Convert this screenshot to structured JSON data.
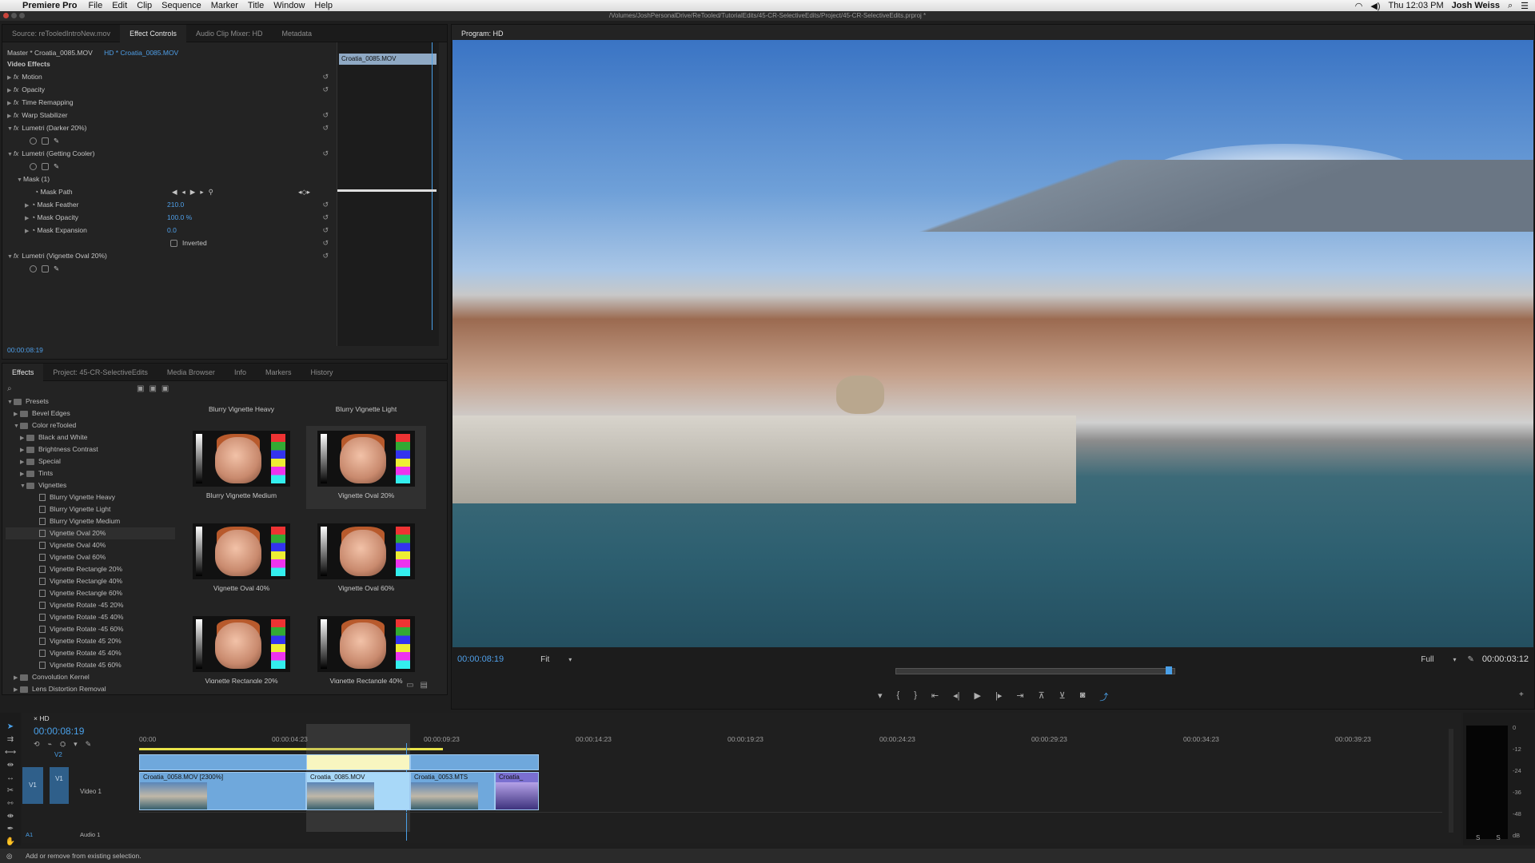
{
  "menubar": {
    "app_name": "Premiere Pro",
    "items": [
      "File",
      "Edit",
      "Clip",
      "Sequence",
      "Marker",
      "Title",
      "Window",
      "Help"
    ],
    "clock": "Thu 12:03 PM",
    "user": "Josh Weiss"
  },
  "window_title": "/Volumes/JoshPersonalDrive/ReTooled/TutorialEdits/45-CR-SelectiveEdits/Project/45-CR-SelectiveEdits.prproj *",
  "top_left_tabs": [
    "Source: reTooledIntroNew.mov",
    "Effect Controls",
    "Audio Clip Mixer: HD",
    "Metadata"
  ],
  "effect_controls": {
    "master_label": "Master * Croatia_0085.MOV",
    "sequence_label": "HD * Croatia_0085.MOV",
    "section": "Video Effects",
    "mini_clip": "Croatia_0085.MOV",
    "effects": [
      "Motion",
      "Opacity",
      "Time Remapping",
      "Warp Stabilizer",
      "Lumetri (Darker 20%)",
      "Lumetri (Getting Cooler)"
    ],
    "mask": "Mask (1)",
    "mask_props": [
      {
        "name": "Mask Path",
        "value": ""
      },
      {
        "name": "Mask Feather",
        "value": "210.0"
      },
      {
        "name": "Mask Opacity",
        "value": "100.0 %"
      },
      {
        "name": "Mask Expansion",
        "value": "0.0"
      }
    ],
    "inverted_label": "Inverted",
    "last_effect": "Lumetri (Vignette Oval 20%)",
    "timecode": "00:00:08:19"
  },
  "bottom_left_tabs": [
    "Effects",
    "Project: 45-CR-SelectiveEdits",
    "Media Browser",
    "Info",
    "Markers",
    "History"
  ],
  "effects_tree": [
    "Presets",
    "Bevel Edges",
    "Color reTooled",
    "Black and White",
    "Brightness Contrast",
    "Special",
    "Tints",
    "Vignettes",
    "Blurry Vignette Heavy",
    "Blurry Vignette Light",
    "Blurry Vignette Medium",
    "Vignette Oval 20%",
    "Vignette Oval 40%",
    "Vignette Oval 60%",
    "Vignette Rectangle 20%",
    "Vignette Rectangle 40%",
    "Vignette Rectangle 60%",
    "Vignette Rotate -45 20%",
    "Vignette Rotate -45 40%",
    "Vignette Rotate -45 60%",
    "Vignette Rotate 45 20%",
    "Vignette Rotate 45 40%",
    "Vignette Rotate 45 60%",
    "Convolution Kernel",
    "Lens Distortion Removal"
  ],
  "thumbnails": {
    "top_labels": [
      "Blurry Vignette Heavy",
      "Blurry Vignette Light"
    ],
    "items": [
      "Blurry Vignette Medium",
      "Vignette Oval 20%",
      "Vignette Oval 40%",
      "Vignette Oval 60%",
      "Vignette Rectangle 20%",
      "Vignette Rectangle 40%"
    ]
  },
  "program": {
    "tab": "Program: HD",
    "timecode": "00:00:08:19",
    "fit": "Fit",
    "quality": "Full",
    "duration": "00:00:03:12"
  },
  "timeline": {
    "tab": "HD",
    "timecode": "00:00:08:19",
    "ruler": [
      "00:00",
      "00:00:04:23",
      "00:00:09:23",
      "00:00:14:23",
      "00:00:19:23",
      "00:00:24:23",
      "00:00:29:23",
      "00:00:34:23",
      "00:00:39:23"
    ],
    "tracks": {
      "v2": "V2",
      "v1": "V1",
      "video1": "Video 1",
      "a1": "A1",
      "audio1": "Audio 1"
    },
    "clips": [
      "Croatia_0058.MOV [2300%]",
      "Croatia_0085.MOV",
      "Croatia_0053.MTS",
      "Croatia_"
    ]
  },
  "meter_ticks": [
    "0",
    "-12",
    "-24",
    "-36",
    "-48",
    "dB"
  ],
  "status": "Add or remove from existing selection."
}
